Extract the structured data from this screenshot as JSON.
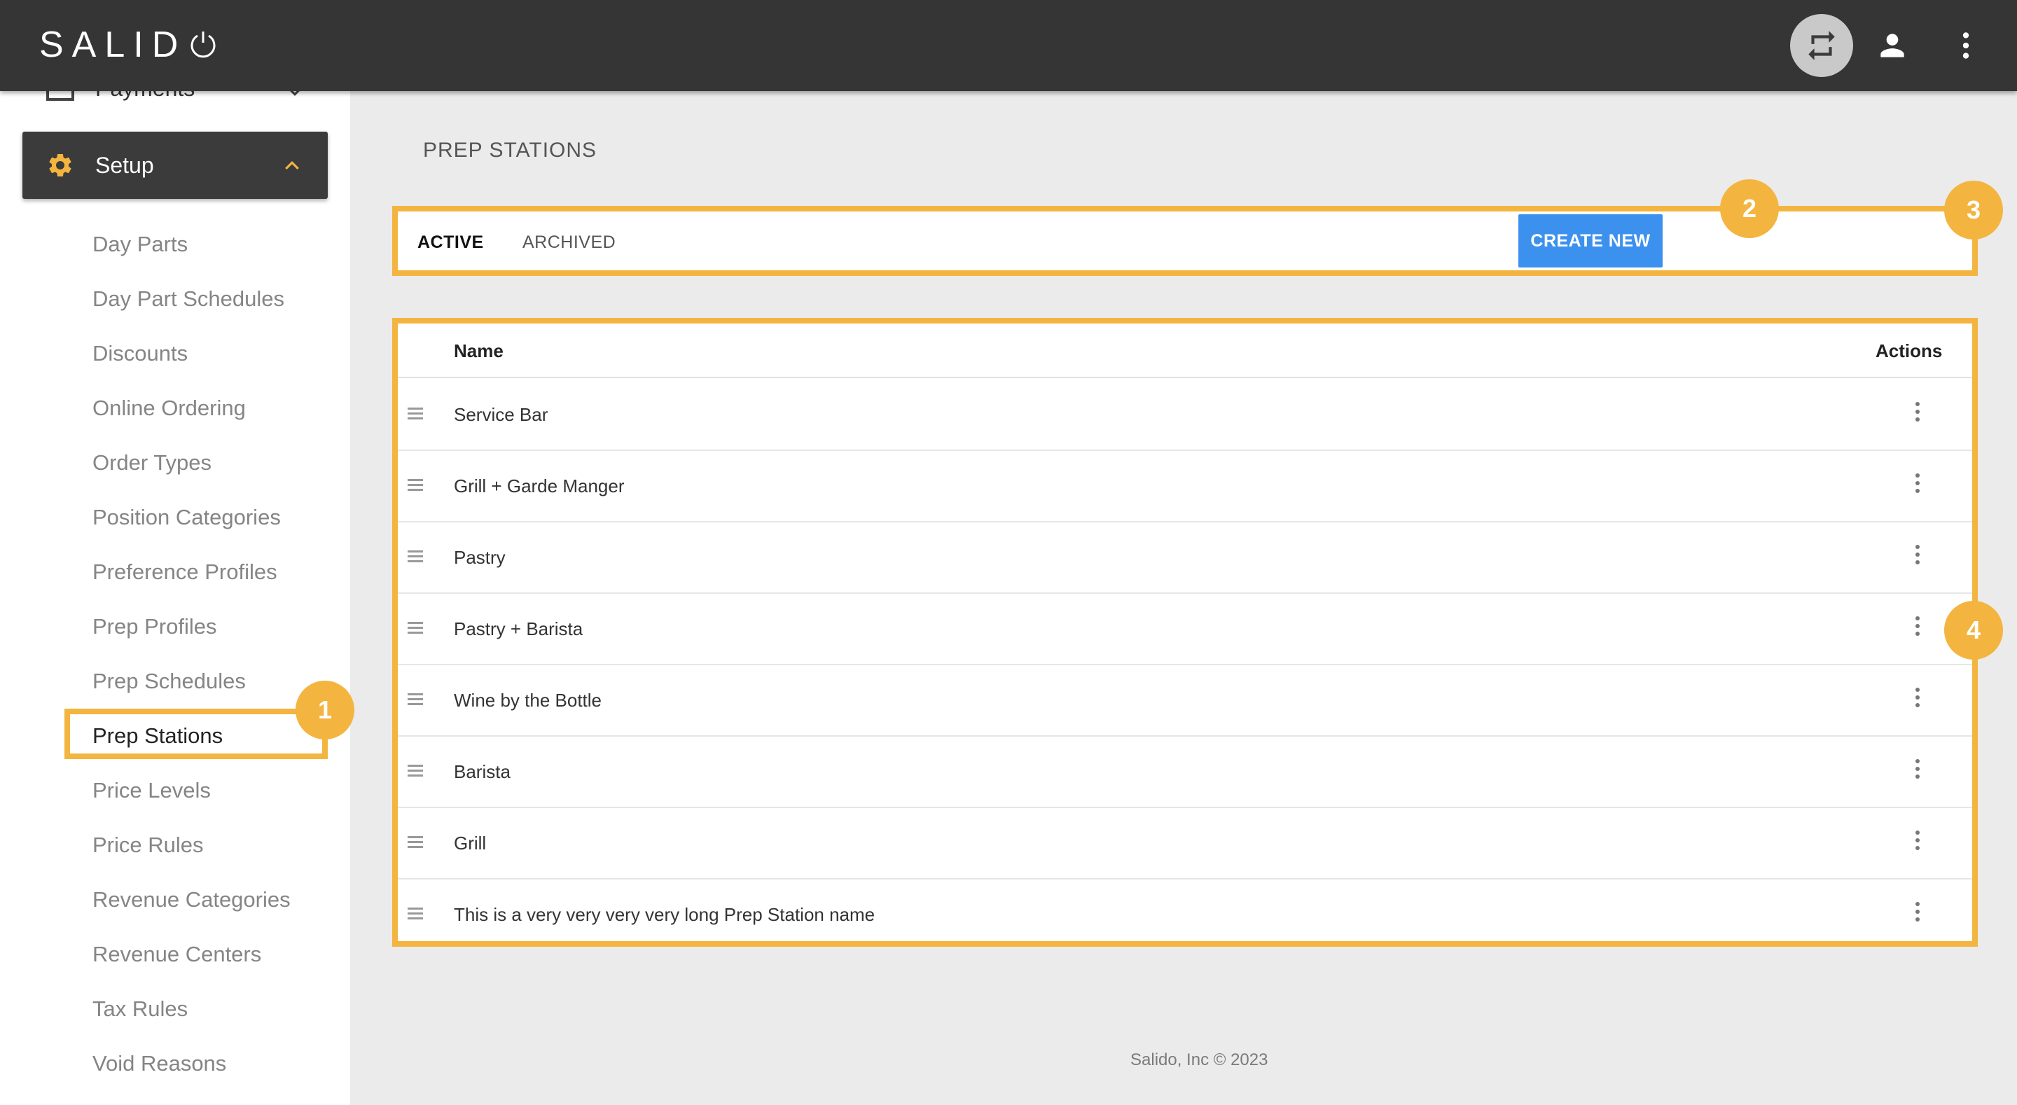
{
  "header": {
    "logo_text": "SALID",
    "icons": [
      "swap-icon",
      "user-icon",
      "more-vertical-icon"
    ],
    "swap_button_color": "#c9c9c9"
  },
  "sidebar": {
    "payments_label": "Payments",
    "setup_label": "Setup",
    "items": [
      {
        "label": "Day Parts"
      },
      {
        "label": "Day Part Schedules"
      },
      {
        "label": "Discounts"
      },
      {
        "label": "Online Ordering"
      },
      {
        "label": "Order Types"
      },
      {
        "label": "Position Categories"
      },
      {
        "label": "Preference Profiles"
      },
      {
        "label": "Prep Profiles"
      },
      {
        "label": "Prep Schedules"
      },
      {
        "label": "Prep Stations",
        "active": true
      },
      {
        "label": "Price Levels"
      },
      {
        "label": "Price Rules"
      },
      {
        "label": "Revenue Categories"
      },
      {
        "label": "Revenue Centers"
      },
      {
        "label": "Tax Rules"
      },
      {
        "label": "Void Reasons"
      }
    ]
  },
  "main": {
    "page_title": "PREP STATIONS",
    "tabs": [
      {
        "label": "ACTIVE",
        "active": true
      },
      {
        "label": "ARCHIVED",
        "active": false
      }
    ],
    "create_button_label": "CREATE NEW",
    "table": {
      "columns": [
        "Name",
        "Actions"
      ],
      "rows": [
        {
          "name": "Service Bar"
        },
        {
          "name": "Grill + Garde Manger"
        },
        {
          "name": "Pastry"
        },
        {
          "name": "Pastry + Barista"
        },
        {
          "name": "Wine by the Bottle"
        },
        {
          "name": "Barista"
        },
        {
          "name": "Grill"
        },
        {
          "name": "This is a very very very very long Prep Station name"
        }
      ]
    }
  },
  "callouts": [
    "1",
    "2",
    "3",
    "4"
  ],
  "footer": {
    "text": "Salido, Inc © 2023"
  },
  "colors": {
    "accent_yellow": "#f3b53f",
    "primary_blue": "#3d91ee",
    "topbar": "#353535",
    "setup_active": "#3b3b3b"
  }
}
